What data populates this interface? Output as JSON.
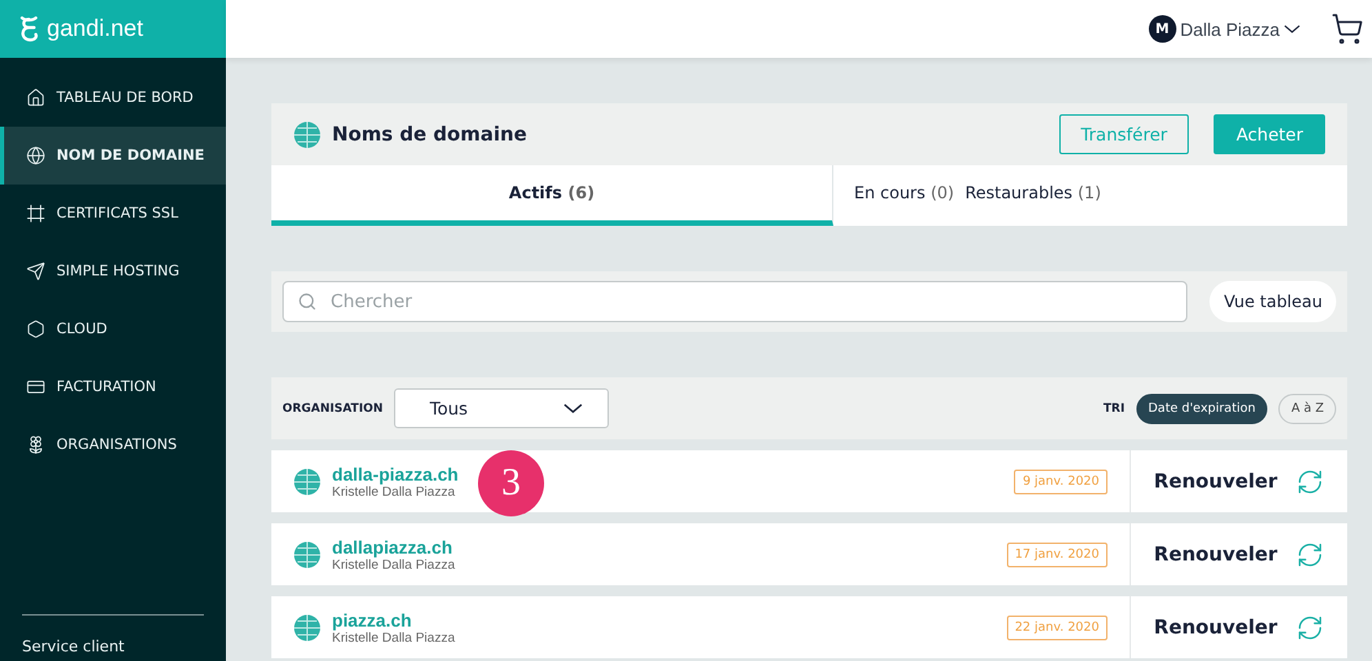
{
  "logo": {
    "text": "gandi.net"
  },
  "sidebar": {
    "items": [
      {
        "label": "TABLEAU DE BORD",
        "selected": false
      },
      {
        "label": "NOM DE DOMAINE",
        "selected": true
      },
      {
        "label": "CERTIFICATS SSL",
        "selected": false
      },
      {
        "label": "SIMPLE HOSTING",
        "selected": false
      },
      {
        "label": "CLOUD",
        "selected": false
      },
      {
        "label": "FACTURATION",
        "selected": false
      },
      {
        "label": "ORGANISATIONS",
        "selected": false
      }
    ],
    "footer": "Service client"
  },
  "user": {
    "initial": "M",
    "name": "Dalla Piazza"
  },
  "panel": {
    "title": "Noms de domaine",
    "buttons": [
      {
        "label": "Transférer",
        "kind": "outline"
      },
      {
        "label": "Acheter",
        "kind": "solid"
      }
    ],
    "tabs": [
      {
        "label": "Actifs",
        "count": "(6)",
        "selected": true
      },
      {
        "label": "En cours",
        "count": "(0)",
        "selected": false
      },
      {
        "label": "Restaurables",
        "count": "(1)",
        "selected": false
      }
    ]
  },
  "search": {
    "placeholder": "Chercher",
    "view_button": "Vue tableau"
  },
  "filter": {
    "label": "ORGANISATION",
    "value": "Tous",
    "sort_label": "TRI",
    "sort_options": [
      {
        "label": "Date d'expiration",
        "selected": true
      },
      {
        "label": "A à Z",
        "selected": false
      }
    ]
  },
  "domains": [
    {
      "name": "dalla-piazza.ch",
      "owner": "Kristelle Dalla Piazza",
      "expiry": "9 janv. 2020",
      "action": "Renouveler"
    },
    {
      "name": "dallapiazza.ch",
      "owner": "Kristelle Dalla Piazza",
      "expiry": "17 janv. 2020",
      "action": "Renouveler"
    },
    {
      "name": "piazza.ch",
      "owner": "Kristelle Dalla Piazza",
      "expiry": "22 janv. 2020",
      "action": "Renouveler"
    }
  ],
  "callout": {
    "text": "3"
  }
}
